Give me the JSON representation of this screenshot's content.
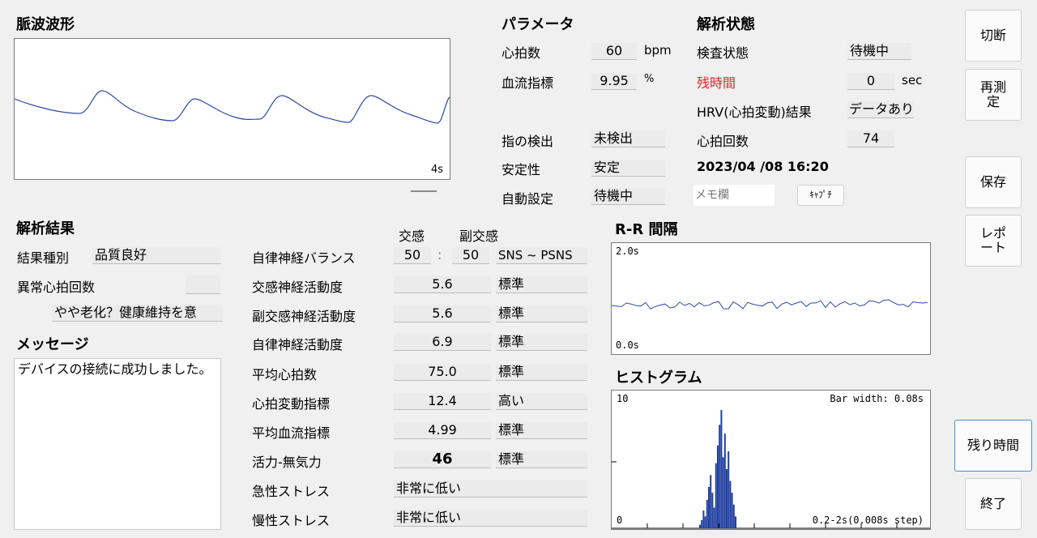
{
  "pulse": {
    "title": "脈波波形",
    "time_label": "4s"
  },
  "params": {
    "title": "パラメータ",
    "hr_label": "心拍数",
    "hr_value": "60",
    "hr_unit": "bpm",
    "flow_label": "血流指標",
    "flow_value": "9.95",
    "flow_unit": "%",
    "finger_label": "指の検出",
    "finger_value": "未検出",
    "stability_label": "安定性",
    "stability_value": "安定",
    "auto_label": "自動設定",
    "auto_value": "待機中"
  },
  "analysis_state": {
    "title": "解析状態",
    "status_label": "検査状態",
    "status_value": "待機中",
    "remain_label": "残時間",
    "remain_value": "0",
    "remain_unit": "sec",
    "hrv_label": "HRV(心拍変動)結果",
    "hrv_value": "データあり",
    "beats_label": "心拍回数",
    "beats_value": "74",
    "datetime": "2023/04 /08 16:20",
    "memo_placeholder": "メモ欄",
    "capture_label": "ｷｬﾌﾟﾁ"
  },
  "buttons": {
    "disconnect": "切断",
    "remeasure": "再測定",
    "save": "保存",
    "report": "レポート",
    "remaining": "残り時間",
    "exit": "終了"
  },
  "results": {
    "title": "解析結果",
    "kind_label": "結果種別",
    "kind_value": "品質良好",
    "abnormal_label": "異常心拍回数",
    "abnormal_value": "",
    "aging_value": "やや老化？健康維持を意"
  },
  "message": {
    "title": "メッセージ",
    "text": "デバイスの接続に成功しました。"
  },
  "autonomic": {
    "col_sym": "交感",
    "col_para": "副交感",
    "balance_label": "自律神経バランス",
    "balance_sym": "50",
    "balance_sep": ":",
    "balance_para": "50",
    "balance_tag": "SNS ~ PSNS",
    "rows": [
      {
        "label": "交感神経活動度",
        "value": "5.6",
        "tag": "標準"
      },
      {
        "label": "副交感神経活動度",
        "value": "5.6",
        "tag": "標準"
      },
      {
        "label": "自律神経活動度",
        "value": "6.9",
        "tag": "標準"
      },
      {
        "label": "平均心拍数",
        "value": "75.0",
        "tag": "標準"
      },
      {
        "label": "心拍変動指標",
        "value": "12.4",
        "tag": "高い"
      },
      {
        "label": "平均血流指標",
        "value": "4.99",
        "tag": "標準"
      },
      {
        "label": "活力-無気力",
        "value": "46",
        "tag": "標準"
      }
    ],
    "acute_label": "急性ストレス",
    "acute_value": "非常に低い",
    "chronic_label": "慢性ストレス",
    "chronic_value": "非常に低い"
  },
  "rr": {
    "title": "R-R 間隔",
    "top": "2.0s",
    "bottom": "0.0s"
  },
  "histogram": {
    "title": "ヒストグラム",
    "ytop": "10",
    "ybottom": "0",
    "bar_width": "Bar width: 0.08s",
    "range": "0.2-2s(0.008s step)"
  },
  "colors": {
    "trace": "#2b4aa8",
    "bars": "#1f3fa0",
    "alert": "#e0262a"
  }
}
